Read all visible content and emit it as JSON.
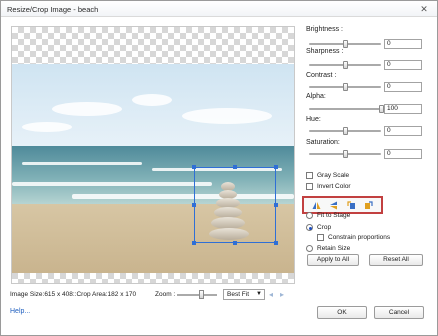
{
  "window": {
    "title": "Resize/Crop Image - beach",
    "close_glyph": "✕"
  },
  "properties": {
    "brightness": {
      "label": "Brightness :",
      "value": "0",
      "level": 0.5
    },
    "sharpness": {
      "label": "Sharpness :",
      "value": "0",
      "level": 0.5
    },
    "contrast": {
      "label": "Contrast :",
      "value": "0",
      "level": 0.5
    },
    "alpha": {
      "label": "Alpha:",
      "value": "100",
      "level": 1.0
    },
    "hue": {
      "label": "Hue:",
      "value": "0",
      "level": 0.5
    },
    "saturation": {
      "label": "Saturation:",
      "value": "0",
      "level": 0.5
    }
  },
  "options": {
    "gray_scale": "Gray Scale",
    "invert_color": "Invert Color",
    "fit_to_stage": "Fit to Stage",
    "crop": "Crop",
    "constrain_proportions": "Constrain proportions",
    "retain_size": "Retain Size",
    "selected_mode": "crop"
  },
  "tools": [
    "flip-horizontal-icon",
    "flip-vertical-icon",
    "rotate-left-icon",
    "rotate-right-icon"
  ],
  "buttons": {
    "apply_to_all": "Apply to All",
    "reset_all": "Reset All",
    "ok": "OK",
    "cancel": "Cancel"
  },
  "status": {
    "text": "Image Size:615 x 408::Crop Area:182 x 170"
  },
  "zoom": {
    "label": "Zoom :",
    "selected": "Best Fit"
  },
  "help": {
    "label": "Help..."
  },
  "colors": {
    "accent": "#2f6fd6",
    "highlight_border": "#c24040",
    "link": "#1f5fbf"
  }
}
